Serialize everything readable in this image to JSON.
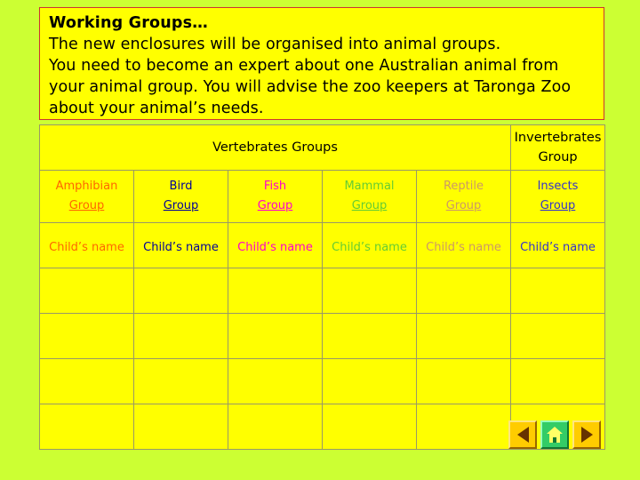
{
  "header": {
    "title": "Working Groups…",
    "lines": [
      "The new enclosures will be organised into animal groups.",
      "You need to become an expert about one Australian animal from",
      "your animal group. You will advise the zoo keepers at Taronga Zoo",
      "about your animal’s needs."
    ]
  },
  "table": {
    "top_headers": {
      "vertebrates": "Vertebrates Groups",
      "invertebrates_line1": "Invertebrates",
      "invertebrates_line2": "Group"
    },
    "columns": [
      {
        "name_line1": "Amphibian",
        "name_line2": "Group",
        "child": "Child’s name",
        "color": "#ff6600"
      },
      {
        "name_line1": "Bird",
        "name_line2": "Group",
        "child": "Child’s name",
        "color": "#000099"
      },
      {
        "name_line1": "Fish",
        "name_line2": "Group",
        "child": "Child’s name",
        "color": "#ff00cc"
      },
      {
        "name_line1": "Mammal",
        "name_line2": "Group",
        "child": "Child’s name",
        "color": "#66cc33"
      },
      {
        "name_line1": "Reptile",
        "name_line2": "Group",
        "child": "Child’s name",
        "color": "#cc9966"
      },
      {
        "name_line1": "Insects",
        "name_line2": "Group",
        "child": "Child’s name",
        "color": "#3333cc"
      }
    ],
    "empty_rows": 4
  },
  "nav": {
    "back": "back-arrow",
    "home": "home",
    "forward": "forward-arrow"
  },
  "colors": {
    "page_background": "#ccff33",
    "panel": "#ffff00",
    "panel_border": "#cc3333",
    "grid_border": "#999966"
  }
}
